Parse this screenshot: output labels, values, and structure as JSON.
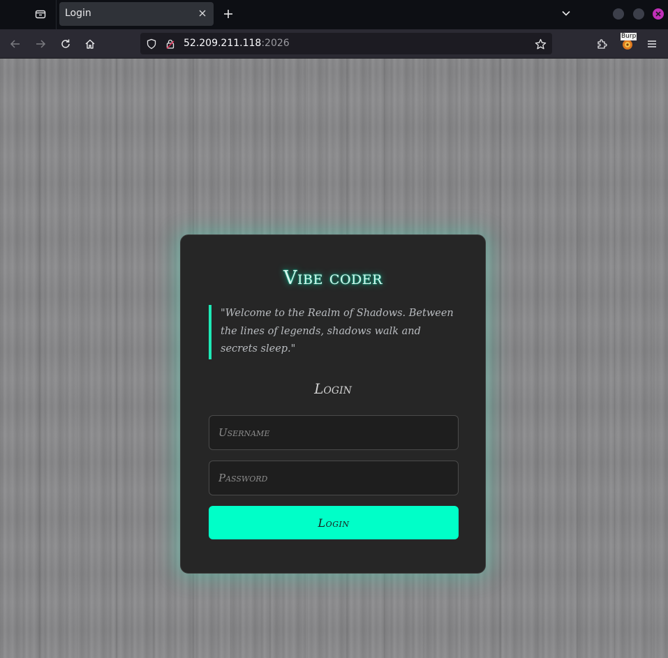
{
  "browser": {
    "tab": {
      "title": "Login"
    },
    "url": {
      "host": "52.209.211.118",
      "port": ":2026"
    },
    "extension_badge": "Burp",
    "colors": {
      "accent_close": "#c030b8",
      "chrome_bg": "#0d0f14",
      "toolbar_bg": "#2b2a33"
    }
  },
  "page": {
    "brand": "Vibe coder",
    "quote": "\"Welcome to the Realm of Shadows. Between the lines of legends, shadows walk and secrets sleep.\"",
    "login_heading": "Login",
    "username_placeholder": "Username",
    "password_placeholder": "Password",
    "login_button": "Login",
    "colors": {
      "accent": "#00ffc8",
      "card_bg": "#262626",
      "quote_border": "#1de9b6"
    }
  },
  "icons": {
    "tab_list": "tab-list-icon",
    "tab_close": "close-icon",
    "new_tab": "plus-icon",
    "tabs_dropdown": "chevron-down-icon",
    "back": "back-arrow-icon",
    "forward": "forward-arrow-icon",
    "reload": "reload-icon",
    "home": "home-icon",
    "tracking_protection": "shield-icon",
    "insecure_connection": "lock-warning-icon",
    "bookmark": "star-icon",
    "extensions": "puzzle-icon",
    "menu": "hamburger-menu-icon"
  }
}
